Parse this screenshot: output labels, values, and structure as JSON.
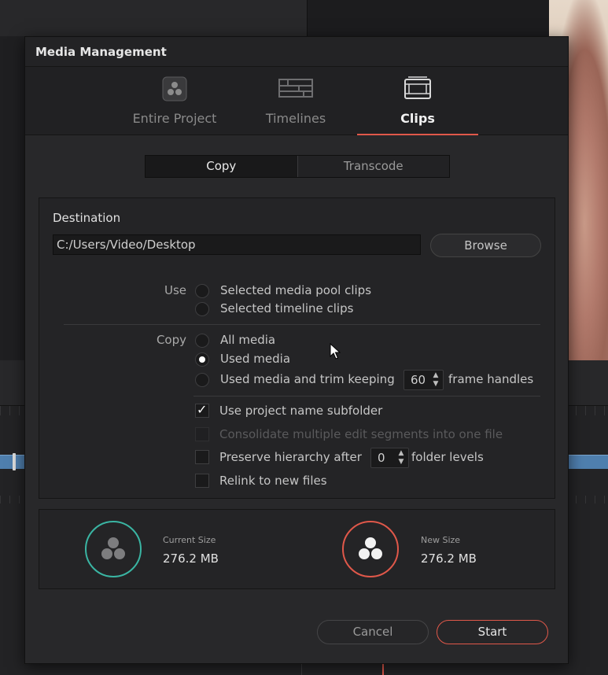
{
  "dialog": {
    "title": "Media Management"
  },
  "tabs": [
    {
      "label": "Entire Project",
      "icon": "resolve-logo-icon"
    },
    {
      "label": "Timelines",
      "icon": "timeline-icon"
    },
    {
      "label": "Clips",
      "icon": "clip-filmstrip-icon",
      "active": true
    }
  ],
  "mode": {
    "copy_label": "Copy",
    "transcode_label": "Transcode",
    "selected": "Copy"
  },
  "destination": {
    "label": "Destination",
    "path": "C:/Users/Video/Desktop",
    "browse_label": "Browse"
  },
  "use": {
    "label": "Use",
    "options": [
      "Selected media pool clips",
      "Selected timeline clips"
    ]
  },
  "copy": {
    "label": "Copy",
    "options": [
      "All media",
      "Used media",
      "Used media and trim keeping"
    ],
    "selected": "Used media",
    "frame_handles_value": "60",
    "frame_handles_suffix": "frame handles"
  },
  "checks": {
    "subfolder": "Use project name subfolder",
    "consolidate": "Consolidate multiple edit segments into one file",
    "preserve_prefix": "Preserve hierarchy after",
    "preserve_value": "0",
    "preserve_suffix": "folder levels",
    "relink": "Relink to new files"
  },
  "sizes": {
    "current_caption": "Current Size",
    "current_value": "276.2 MB",
    "new_caption": "New Size",
    "new_value": "276.2 MB"
  },
  "footer": {
    "cancel_label": "Cancel",
    "start_label": "Start"
  },
  "colors": {
    "accent": "#e0584a",
    "current_ring": "#3ab5a3",
    "new_ring": "#e0584a",
    "clip_blue": "#4f7fae"
  }
}
